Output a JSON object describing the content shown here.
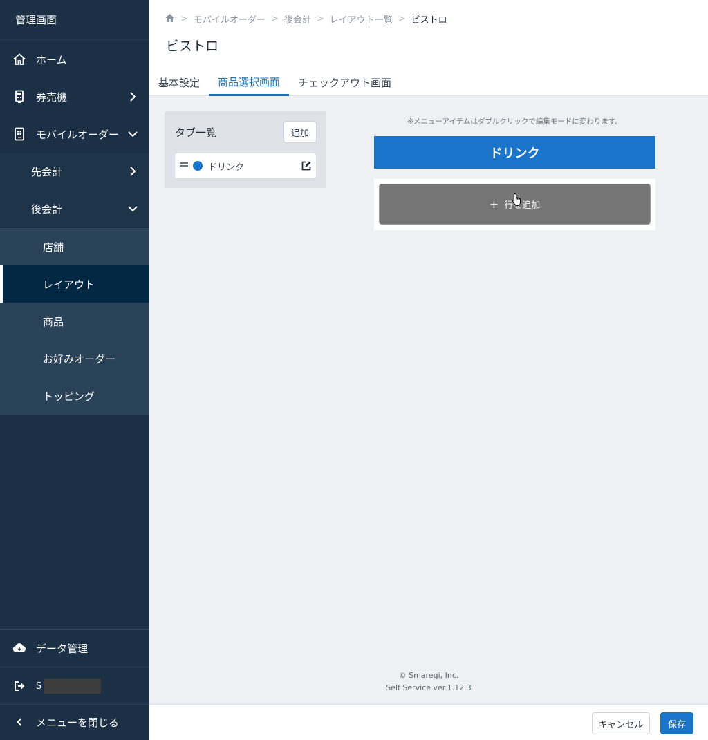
{
  "sidebar": {
    "title": "管理画面",
    "home": "ホーム",
    "ticket_machine": "券売機",
    "mobile_order": "モバイルオーダー",
    "prepay": "先会計",
    "postpay": "後会計",
    "store": "店舗",
    "layout": "レイアウト",
    "product": "商品",
    "custom_order": "お好みオーダー",
    "topping": "トッピング",
    "data_management": "データ管理",
    "user_initial": "S",
    "close_menu": "メニューを閉じる"
  },
  "breadcrumb": {
    "items": [
      "モバイルオーダー",
      "後会計",
      "レイアウト一覧"
    ],
    "current": "ビストロ"
  },
  "page": {
    "title": "ビストロ"
  },
  "tabs": [
    "基本設定",
    "商品選択画面",
    "チェックアウト画面"
  ],
  "tab_list": {
    "title": "タブ一覧",
    "add_label": "追加",
    "items": [
      {
        "label": "ドリンク",
        "color": "#1a74c9"
      }
    ]
  },
  "preview": {
    "hint": "※メニューアイテムはダブルクリックで編集モードに変わります。",
    "category": "ドリンク",
    "add_row_label": "行を追加"
  },
  "footer": {
    "copyright": "© Smaregi, Inc.",
    "version": "Self Service ver.1.12.3"
  },
  "actions": {
    "cancel": "キャンセル",
    "save": "保存"
  },
  "colors": {
    "accent": "#1a74c9",
    "sidebar": "#1b3044"
  }
}
